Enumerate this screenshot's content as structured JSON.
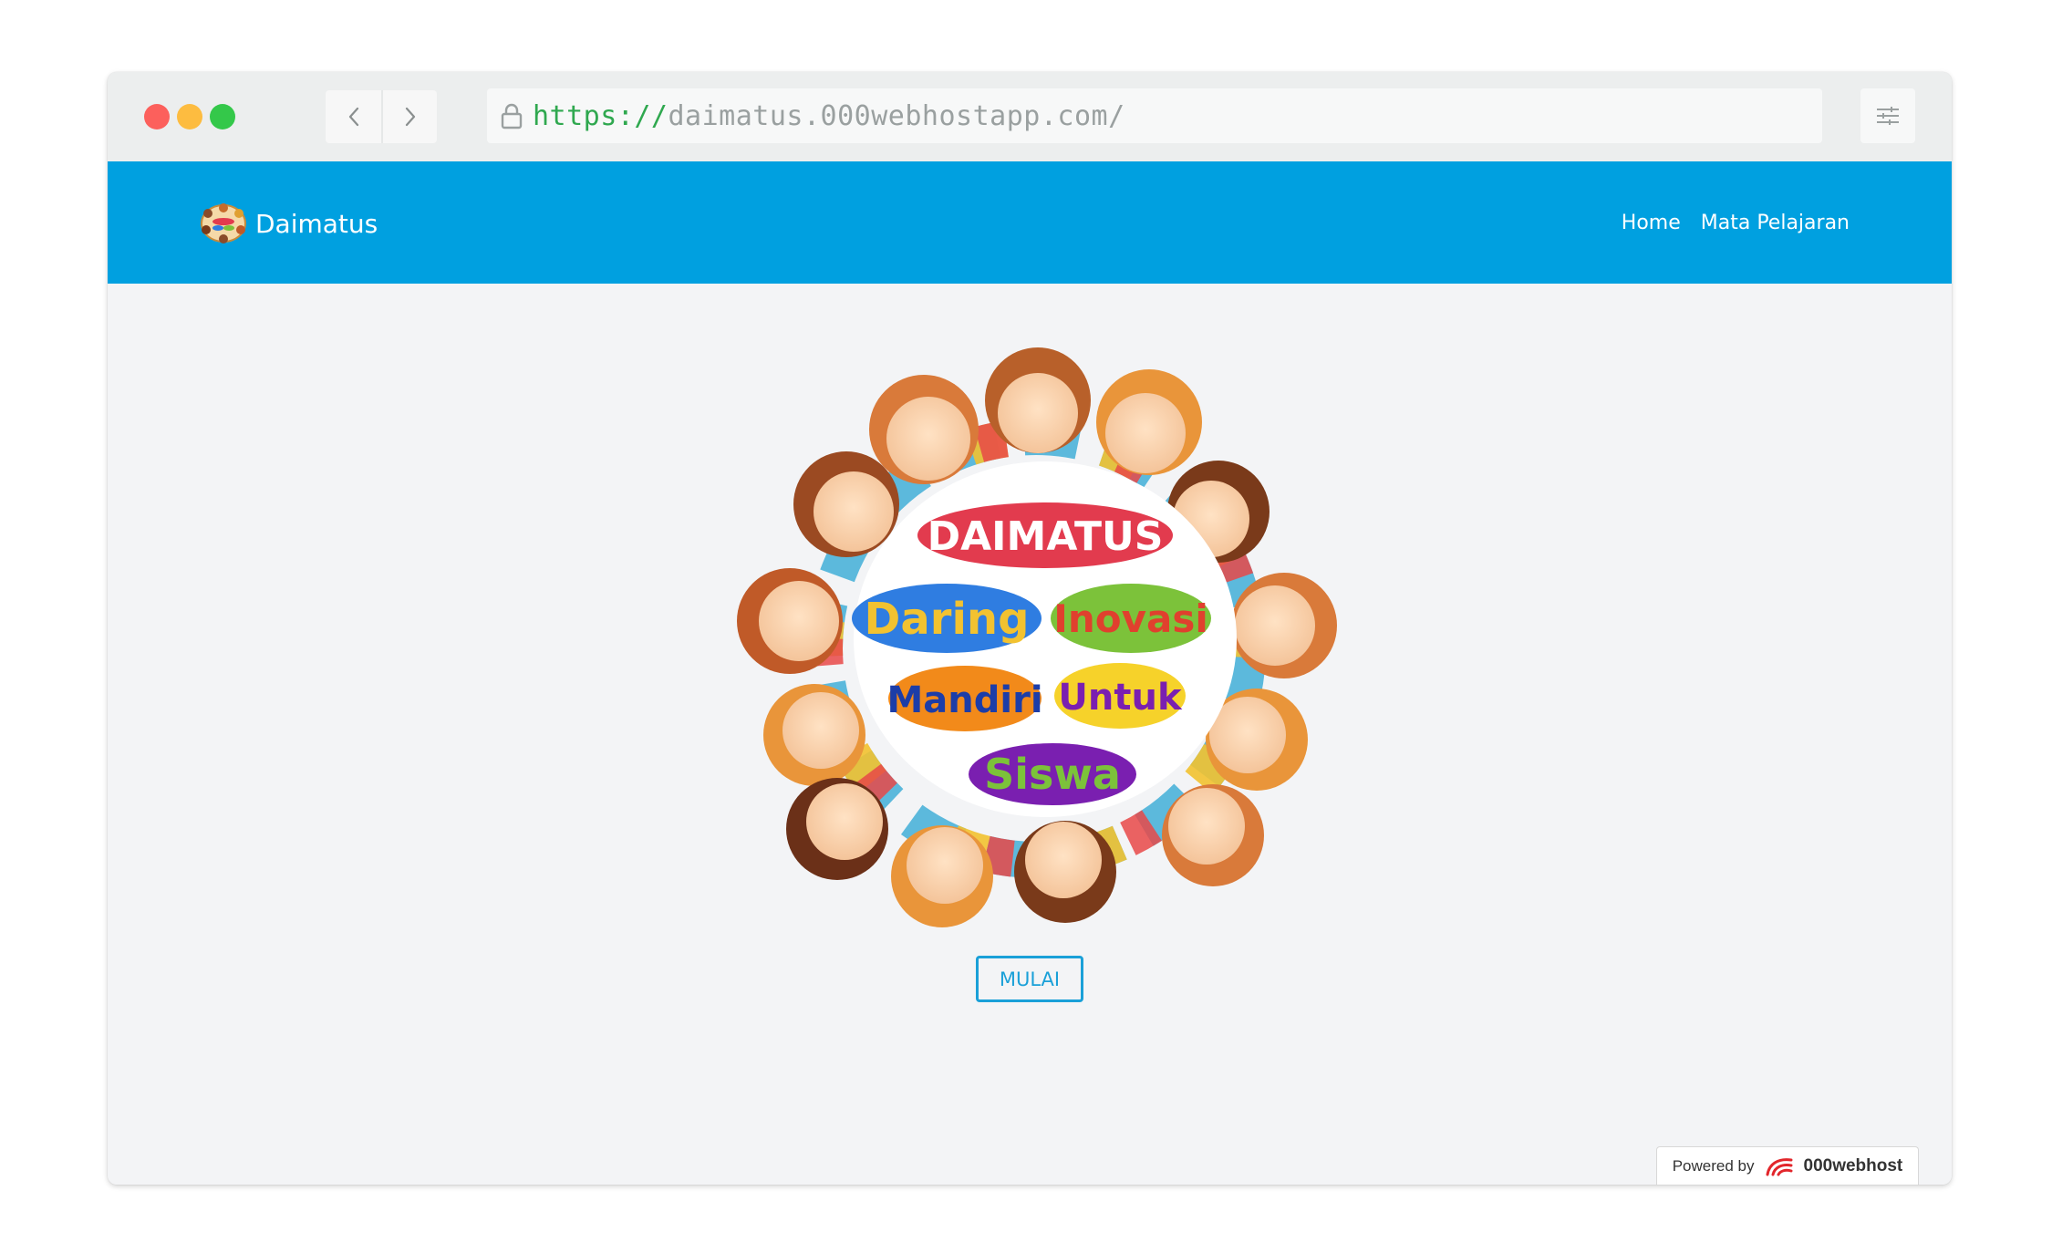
{
  "browser": {
    "url_scheme": "https://",
    "url_rest": "daimatus.000webhostapp.com/"
  },
  "navbar": {
    "brand": "Daimatus",
    "links": [
      "Home",
      "Mata Pelajaran"
    ],
    "color": "#00a0e0"
  },
  "hero": {
    "title": "DAIMATUS",
    "words": [
      "Daring",
      "Inovasi",
      "Mandiri",
      "Untuk",
      "Siswa"
    ]
  },
  "main": {
    "start_button": "MULAI"
  },
  "footer": {
    "powered_by": "Powered by",
    "host": "000webhost"
  }
}
